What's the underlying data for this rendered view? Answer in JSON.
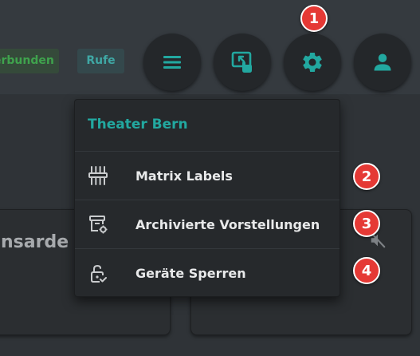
{
  "topbar": {
    "status_badge": "erbunden",
    "call_badge": "Rufe"
  },
  "toolbar": {
    "buttons": [
      {
        "icon": "menu-icon"
      },
      {
        "icon": "screen-touch-icon"
      },
      {
        "icon": "gear-icon"
      },
      {
        "icon": "user-icon"
      }
    ]
  },
  "markers": [
    "1",
    "2",
    "3",
    "4"
  ],
  "cards": {
    "left_title": "nsarde"
  },
  "menu": {
    "title": "Theater Bern",
    "items": [
      {
        "label": "Matrix Labels",
        "icon": "sliders-icon"
      },
      {
        "label": "Archivierte Vorstellungen",
        "icon": "archive-settings-icon"
      },
      {
        "label": "Geräte Sperren",
        "icon": "lock-check-icon"
      }
    ]
  },
  "colors": {
    "accent": "#22a8a0",
    "marker": "#e53935",
    "background": "#2f3337",
    "button": "#24272a",
    "menu_bg": "#26292c"
  }
}
